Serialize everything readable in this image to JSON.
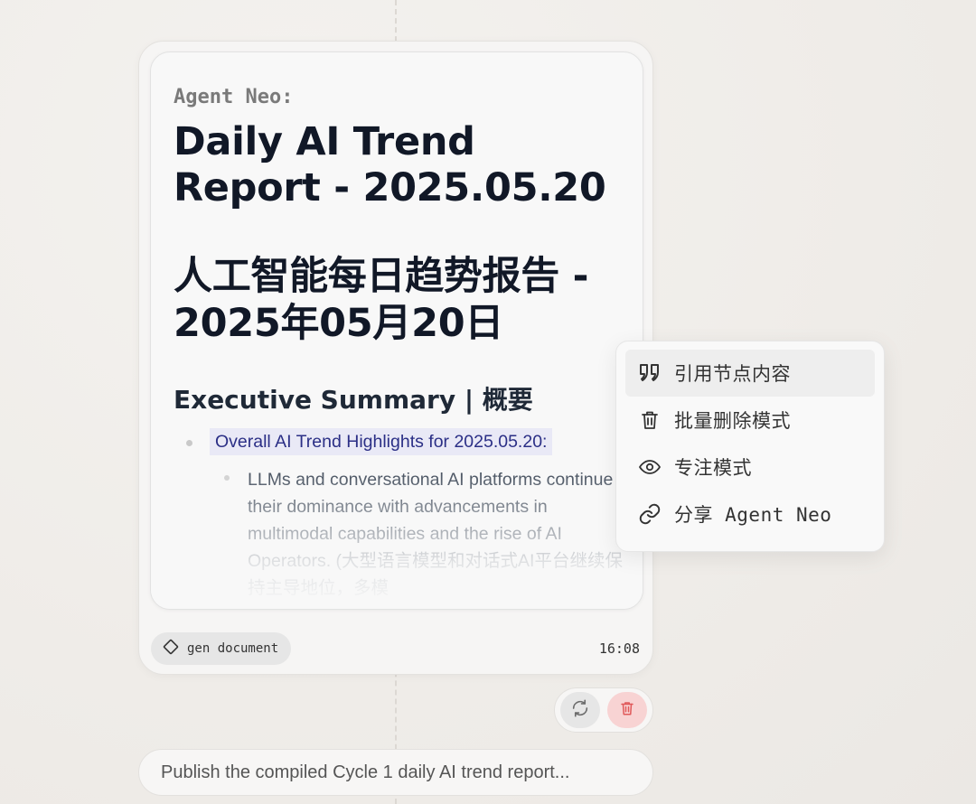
{
  "node": {
    "agent_label": "Agent Neo:",
    "title_en": "Daily AI Trend Report - 2025.05.20",
    "title_cn": "人工智能每日趋势报告 - 2025年05月20日",
    "section_title": "Executive Summary | 概要",
    "highlight_bullet": "Overall AI Trend Highlights for 2025.05.20:",
    "sub_bullet": "LLMs and conversational AI platforms continue their dominance with advancements in multimodal capabilities and the rise of AI Operators. (大型语言模型和对话式AI平台继续保持主导地位，多模",
    "tag": {
      "icon": "diamond-icon",
      "label": "gen document"
    },
    "timestamp": "16:08"
  },
  "actions": {
    "regenerate_icon": "refresh-icon",
    "delete_icon": "trash-icon"
  },
  "next_node": {
    "text": "Publish the compiled Cycle 1 daily AI trend report..."
  },
  "context_menu": {
    "items": [
      {
        "icon": "quote-icon",
        "label": "引用节点内容",
        "active": true
      },
      {
        "icon": "trash-icon",
        "label": "批量删除模式"
      },
      {
        "icon": "eye-icon",
        "label": "专注模式"
      },
      {
        "icon": "link-icon",
        "label": "分享 Agent Neo"
      }
    ]
  },
  "colors": {
    "highlight_bg": "#e9e9f6",
    "highlight_text": "#2b2f86",
    "delete_bg": "#f8d3d3",
    "delete_icon": "#e0595a"
  }
}
